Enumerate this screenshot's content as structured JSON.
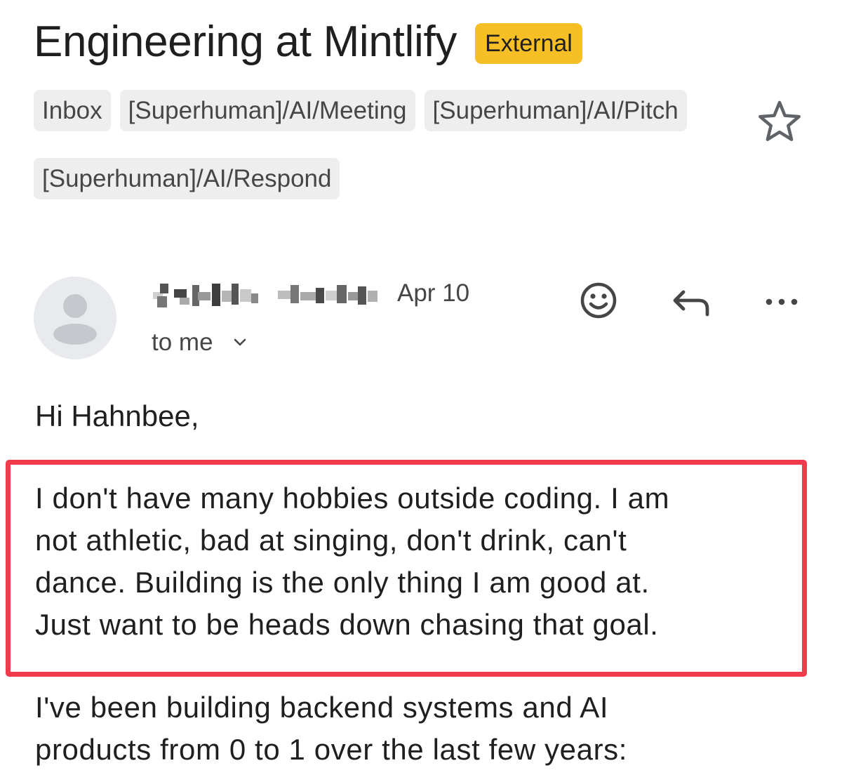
{
  "email": {
    "subject": "Engineering at Mintlify",
    "external_badge": "External",
    "labels": [
      "Inbox",
      "[Superhuman]/AI/Meeting",
      "[Superhuman]/AI/Pitch",
      "[Superhuman]/AI/Respond"
    ],
    "star_icon": "star-outline-icon",
    "date": "Apr 10",
    "recipient": "to me",
    "actions": {
      "emoji_icon": "smiley-icon",
      "reply_icon": "reply-icon",
      "more_icon": "more-horizontal-icon"
    },
    "body": {
      "greeting": "Hi Hahnbee,",
      "highlighted_lines": [
        "I don't have many hobbies outside coding. I am",
        "not athletic, bad at singing, don't drink, can't",
        "dance. Building is the only thing I am good at.",
        "Just want to be heads down chasing that goal."
      ],
      "paragraph_lines": [
        "I've been building backend systems and AI",
        "products from 0 to 1 over the last few years:"
      ]
    }
  },
  "colors": {
    "external_badge_bg": "#f6bf26",
    "chip_bg": "#eeeeee",
    "highlight_border": "#f23a4d",
    "muted_text": "#444746",
    "avatar_bg": "#e8eaed"
  }
}
